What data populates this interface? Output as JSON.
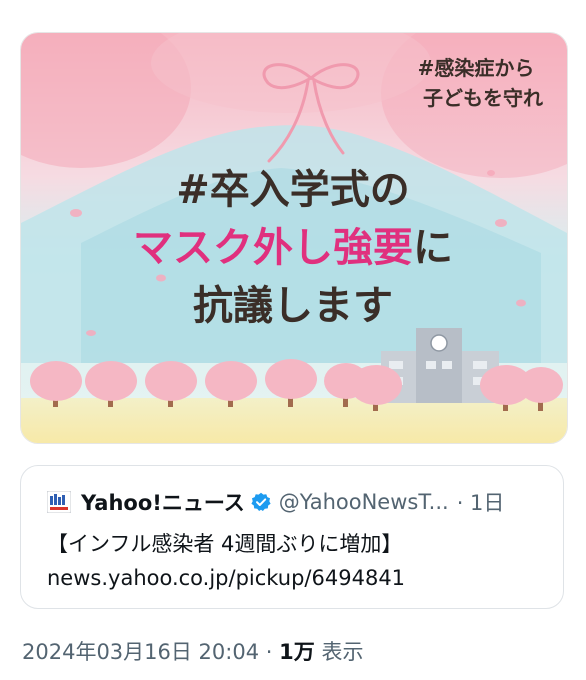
{
  "media": {
    "hashtag_corner_line1": "#感染症から",
    "hashtag_corner_line2": "子どもを守れ",
    "headline_line1": "#卒入学式の",
    "headline_line2_pink": "マスク外し強要",
    "headline_line2_suffix": "に",
    "headline_line3": "抗議します"
  },
  "quote": {
    "source_name": "Yahoo!ニュース",
    "handle": "@YahooNewsT...",
    "time": "· 1日",
    "text": "【インフル感染者 4週間ぶりに増加】",
    "url": "news.yahoo.co.jp/pickup/6494841"
  },
  "meta": {
    "datetime": "2024年03月16日 20:04",
    "separator": "·",
    "views_count": "1万",
    "views_label": "表示"
  },
  "colors": {
    "pink_text": "#e0307e",
    "dark_text": "#3a2e28",
    "verified_blue": "#1d9bf0"
  }
}
